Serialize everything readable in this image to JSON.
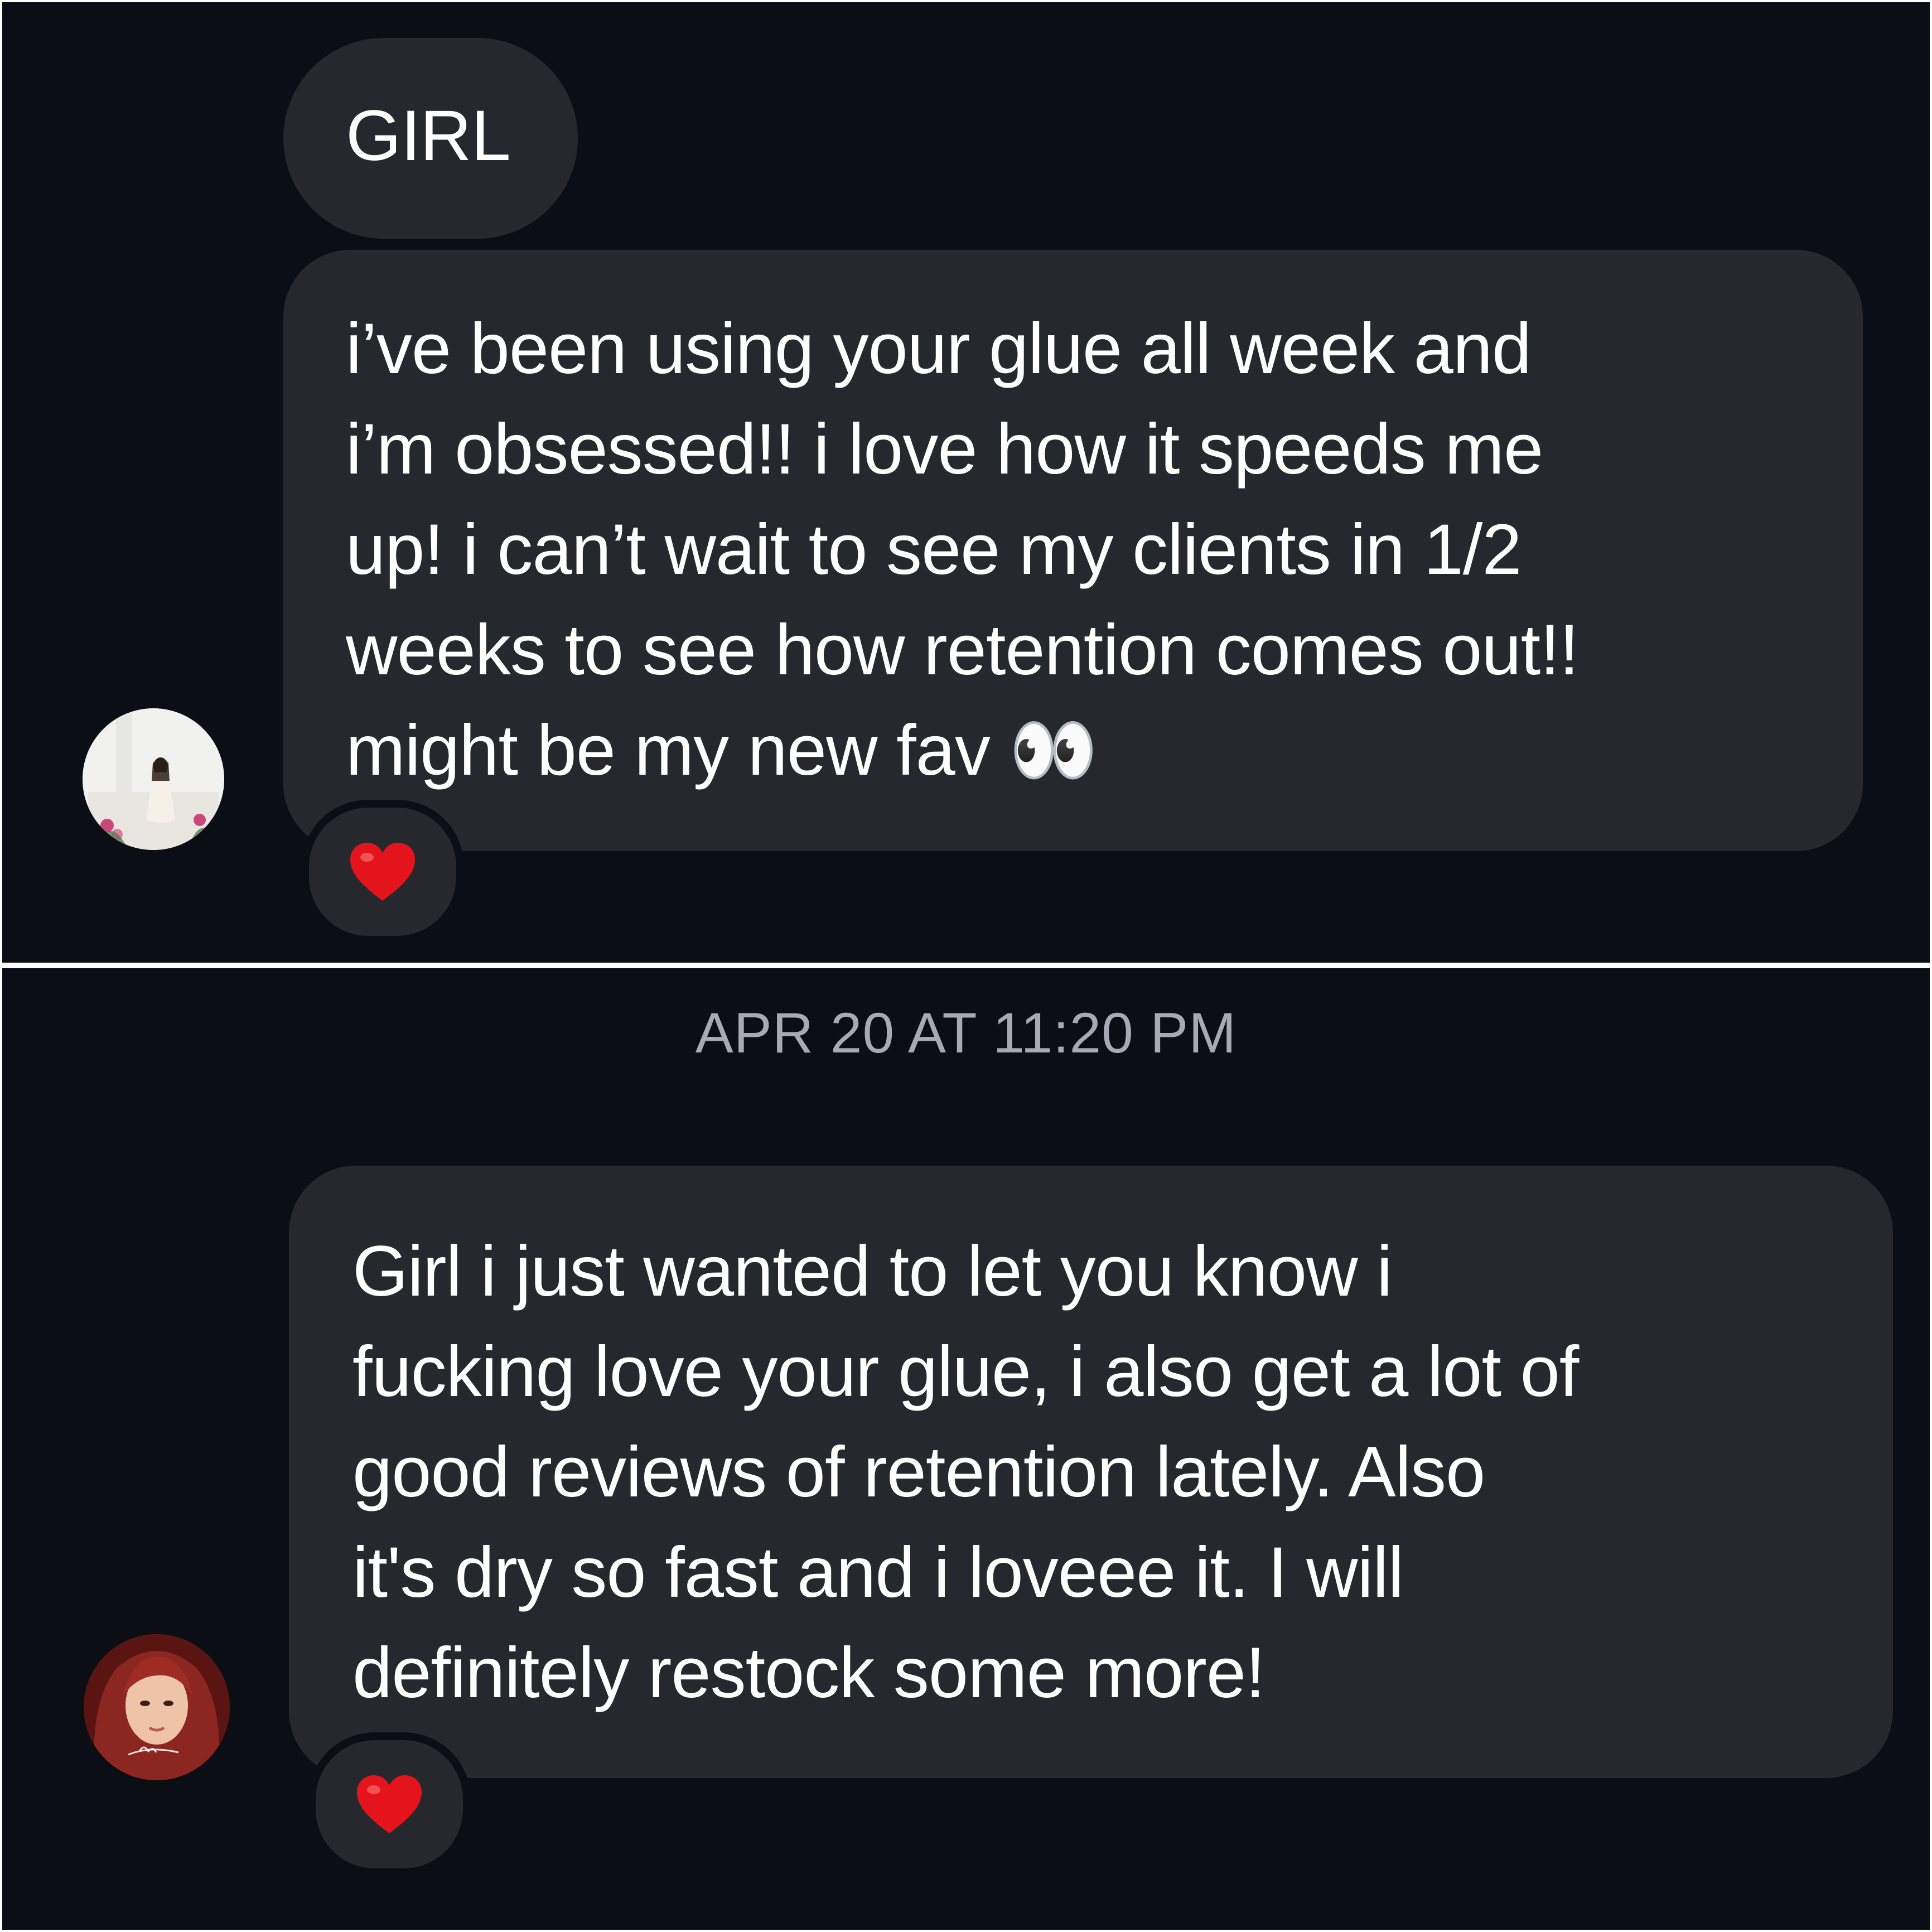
{
  "conversation_1": {
    "messages": [
      {
        "text": "GIRL"
      },
      {
        "lines": [
          "i’ve been using your glue all week and",
          "i’m obsessed!! i love how it speeds me",
          "up! i can’t wait to see my clients in 1/2",
          "weeks to see how retention comes out!!",
          "might be my new fav 👀"
        ]
      }
    ],
    "reaction": {
      "emoji": "❤️",
      "icon": "heart-icon"
    },
    "avatar": {
      "icon": "profile-photo-woman-white-dress"
    }
  },
  "conversation_2": {
    "timestamp": "APR 20 AT 11:20 PM",
    "message": {
      "lines": [
        "Girl i just wanted to let you know i",
        "fucking love your glue, i also get a lot of",
        "good reviews of retention lately. Also",
        "it's dry so fast and i loveee it. I will",
        "definitely restock some more!"
      ]
    },
    "reaction": {
      "emoji": "❤️",
      "icon": "heart-icon"
    },
    "avatar": {
      "icon": "profile-photo-red-hair"
    }
  },
  "colors": {
    "background": "#0b0e14",
    "bubble": "#26282d",
    "text": "#ffffff",
    "timestamp": "#a7aab3",
    "heart": "#e3141b",
    "divider": "#ffffff"
  }
}
